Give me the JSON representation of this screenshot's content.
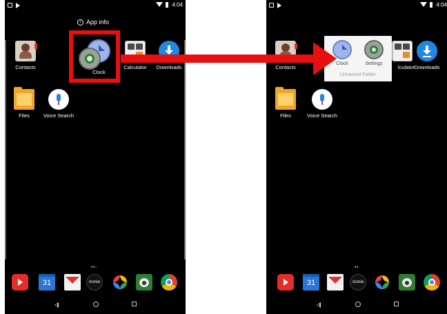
{
  "status_bar": {
    "time": "4:04"
  },
  "left_screen": {
    "app_info_label": "App info",
    "apps": [
      {
        "label": "Contacts"
      },
      {
        "label": "Clock"
      },
      {
        "label": "Calculator"
      },
      {
        "label": "Downloads"
      },
      {
        "label": "Files"
      },
      {
        "label": "Voice Search"
      }
    ],
    "page_indicator": "••◦"
  },
  "right_screen": {
    "apps": [
      {
        "label": "Contacts"
      },
      {
        "label": "lculator"
      },
      {
        "label": "Downloads"
      },
      {
        "label": "Files"
      },
      {
        "label": "Voice Search"
      }
    ],
    "folder": {
      "name": "Unnamed Folder",
      "items": [
        {
          "label": "Clock"
        },
        {
          "label": "Settings"
        }
      ]
    },
    "page_indicator": "••"
  },
  "dock": {
    "calendar_day": "31",
    "iconia_label": "Iconia"
  },
  "colors": {
    "highlight": "#e61010",
    "background": "#000000"
  }
}
